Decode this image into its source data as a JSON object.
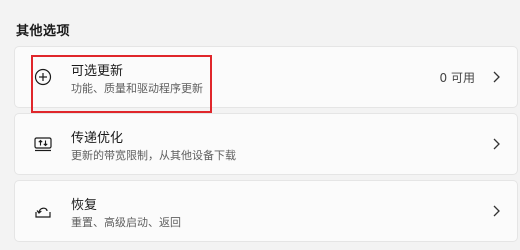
{
  "section": {
    "title": "其他选项"
  },
  "items": [
    {
      "title": "可选更新",
      "subtitle": "功能、质量和驱动程序更新",
      "value": "0 可用",
      "icon": "plus-circle-icon"
    },
    {
      "title": "传递优化",
      "subtitle": "更新的带宽限制，从其他设备下载",
      "icon": "delivery-optimization-icon"
    },
    {
      "title": "恢复",
      "subtitle": "重置、高级启动、返回",
      "icon": "recovery-icon"
    }
  ],
  "colors": {
    "highlight": "#e0262b",
    "background": "#f3f3f3",
    "card": "#fbfbfb"
  }
}
